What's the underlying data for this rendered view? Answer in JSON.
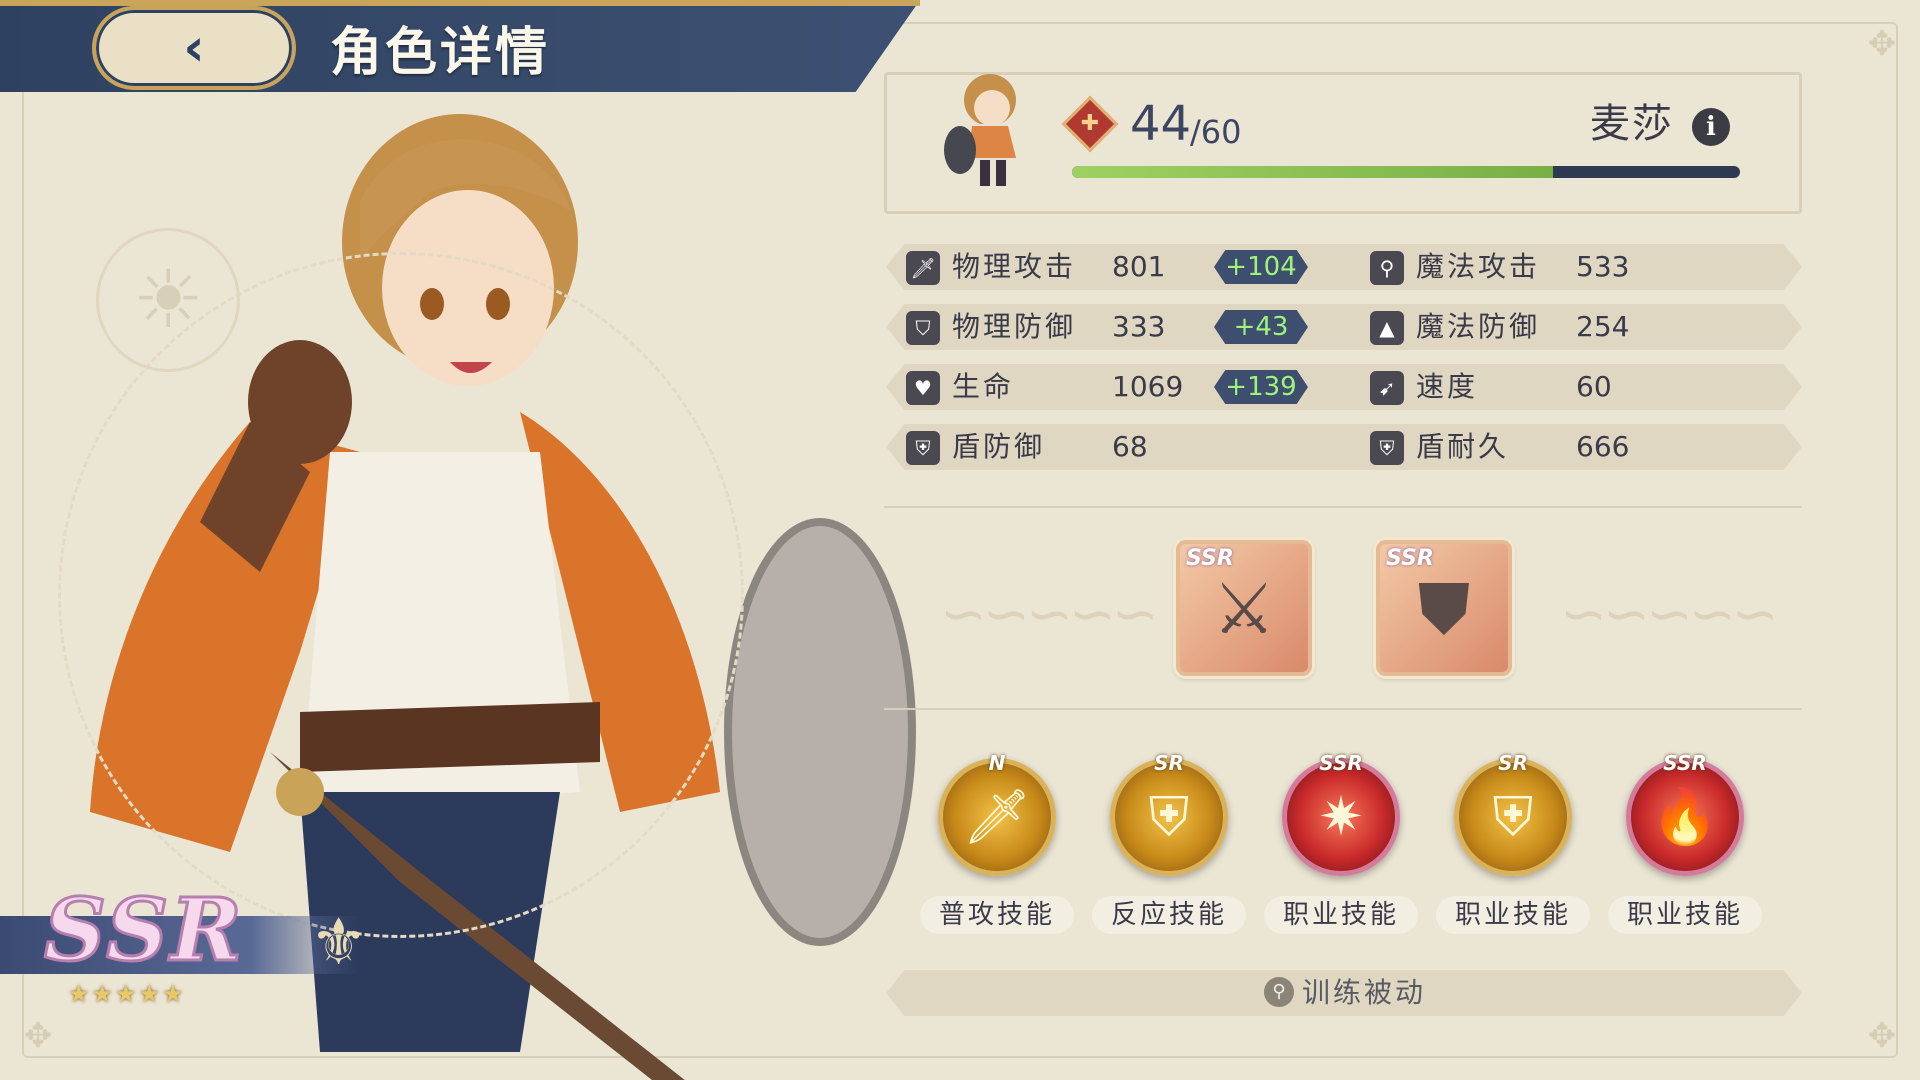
{
  "header": {
    "back_icon": "back-arrow-icon",
    "title": "角色详情"
  },
  "character": {
    "name": "麦莎",
    "level": "44",
    "level_max": "/60",
    "exp_progress": 0.72,
    "rarity": "SSR",
    "stars": "★★★★★"
  },
  "stats": {
    "phys_atk": {
      "label": "物理攻击",
      "value": "801",
      "bonus": "+104",
      "icon": "sword-icon"
    },
    "mag_atk": {
      "label": "魔法攻击",
      "value": "533",
      "icon": "staff-icon"
    },
    "phys_def": {
      "label": "物理防御",
      "value": "333",
      "bonus": "+43",
      "icon": "shield-icon"
    },
    "mag_def": {
      "label": "魔法防御",
      "value": "254",
      "icon": "hat-icon"
    },
    "hp": {
      "label": "生命",
      "value": "1069",
      "bonus": "+139",
      "icon": "heart-icon"
    },
    "speed": {
      "label": "速度",
      "value": "60",
      "icon": "boot-icon"
    },
    "shield_def": {
      "label": "盾防御",
      "value": "68",
      "icon": "shield-plus-icon"
    },
    "shield_dur": {
      "label": "盾耐久",
      "value": "666",
      "icon": "shield-plus-icon"
    }
  },
  "equipment": [
    {
      "rarity": "SSR",
      "icon": "sword-item-icon"
    },
    {
      "rarity": "SSR",
      "icon": "shield-item-icon"
    }
  ],
  "skills": [
    {
      "rarity": "N",
      "label": "普攻技能",
      "icon": "dagger-slash-icon"
    },
    {
      "rarity": "SR",
      "label": "反应技能",
      "icon": "shield-emblem-icon"
    },
    {
      "rarity": "SSR",
      "label": "职业技能",
      "icon": "impact-burst-icon"
    },
    {
      "rarity": "SR",
      "label": "职业技能",
      "icon": "shield-emblem-icon"
    },
    {
      "rarity": "SSR",
      "label": "职业技能",
      "icon": "flame-icon"
    }
  ],
  "training": {
    "label": "训练被动",
    "icon": "search-icon"
  },
  "colors": {
    "background": "#ebe5d4",
    "header": "#2f4160",
    "bonus_text": "#9ff27a",
    "bonus_bg": "#3e4e6e",
    "exp_fill": "#9fd063"
  }
}
